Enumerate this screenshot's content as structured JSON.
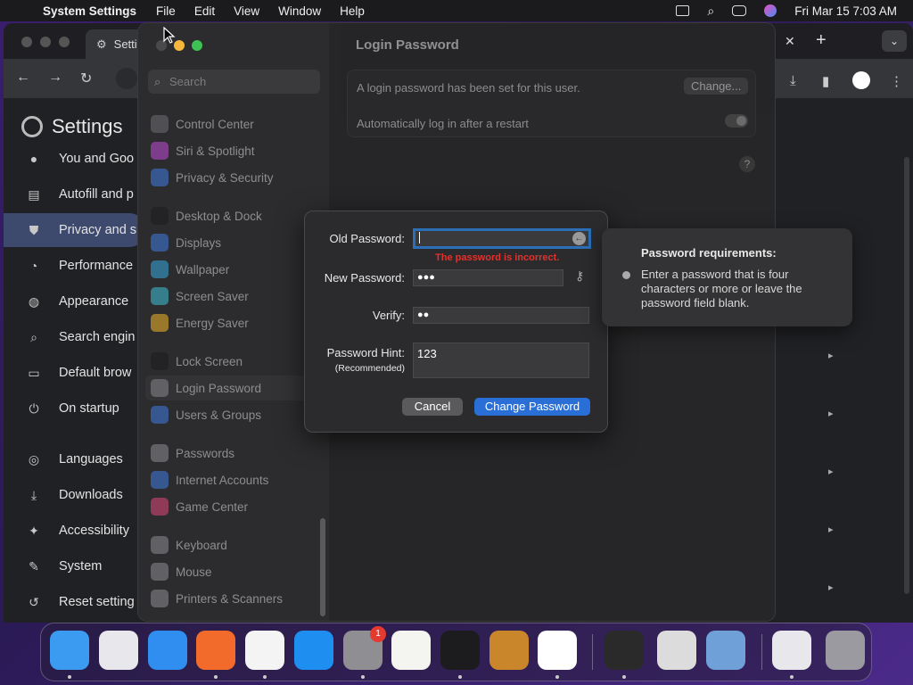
{
  "menubar": {
    "app": "System Settings",
    "items": [
      "File",
      "Edit",
      "View",
      "Window",
      "Help"
    ],
    "datetime": "Fri Mar 15  7:03 AM"
  },
  "chrome": {
    "tab_title": "Setti",
    "settings_title": "Settings",
    "sidebar": [
      {
        "label": "You and Goo",
        "icon": "person-icon"
      },
      {
        "label": "Autofill and p",
        "icon": "clipboard-icon"
      },
      {
        "label": "Privacy and s",
        "icon": "shield-icon",
        "active": true
      },
      {
        "label": "Performance",
        "icon": "speedometer-icon"
      },
      {
        "label": "Appearance",
        "icon": "palette-icon"
      },
      {
        "label": "Search engin",
        "icon": "search-icon"
      },
      {
        "label": "Default brow",
        "icon": "browser-icon"
      },
      {
        "label": "On startup",
        "icon": "power-icon"
      },
      {
        "label": "Languages",
        "icon": "globe-icon"
      },
      {
        "label": "Downloads",
        "icon": "download-icon"
      },
      {
        "label": "Accessibility",
        "icon": "accessibility-icon"
      },
      {
        "label": "System",
        "icon": "wrench-icon"
      },
      {
        "label": "Reset setting",
        "icon": "reset-icon"
      }
    ]
  },
  "system_settings": {
    "search_placeholder": "Search",
    "sidebar": [
      {
        "label": "Control Center",
        "color": "#6e6e73"
      },
      {
        "label": "Siri & Spotlight",
        "color": "#c24bd8"
      },
      {
        "label": "Privacy & Security",
        "color": "#3f7be0"
      },
      {
        "label": "Desktop & Dock",
        "color": "#1c1c1e"
      },
      {
        "label": "Displays",
        "color": "#3f7be0"
      },
      {
        "label": "Wallpaper",
        "color": "#38a8e0"
      },
      {
        "label": "Screen Saver",
        "color": "#3fc2d8"
      },
      {
        "label": "Energy Saver",
        "color": "#f2b52a"
      },
      {
        "label": "Lock Screen",
        "color": "#1c1c1e"
      },
      {
        "label": "Login Password",
        "color": "#8e8e93",
        "selected": true
      },
      {
        "label": "Users & Groups",
        "color": "#3f7be0"
      },
      {
        "label": "Passwords",
        "color": "#8e8e93"
      },
      {
        "label": "Internet Accounts",
        "color": "#3f7be0"
      },
      {
        "label": "Game Center",
        "color": "#e0467a"
      },
      {
        "label": "Keyboard",
        "color": "#8e8e93"
      },
      {
        "label": "Mouse",
        "color": "#8e8e93"
      },
      {
        "label": "Printers & Scanners",
        "color": "#8e8e93"
      }
    ],
    "main_title": "Login Password",
    "password_set_text": "A login password has been set for this user.",
    "change_button": "Change...",
    "auto_login_text": "Automatically log in after a restart",
    "help": "?"
  },
  "dialog": {
    "old_label": "Old Password:",
    "error": "The password is incorrect.",
    "new_label": "New Password:",
    "new_value": "●●●",
    "verify_label": "Verify:",
    "verify_value": "●●",
    "hint_label": "Password Hint:",
    "hint_sub": "(Recommended)",
    "hint_value": "123",
    "cancel": "Cancel",
    "change": "Change Password"
  },
  "tooltip": {
    "title": "Password requirements:",
    "body": "Enter a password that is four characters or more or leave the password field blank."
  },
  "dock": {
    "apps": [
      {
        "name": "finder-icon",
        "color": "#3a9bf0"
      },
      {
        "name": "launchpad-icon",
        "color": "#e8e8ec"
      },
      {
        "name": "safari-icon",
        "color": "#2f8ef0"
      },
      {
        "name": "firefox-icon",
        "color": "#f26b2a"
      },
      {
        "name": "chrome-icon",
        "color": "#f4f4f4"
      },
      {
        "name": "app-store-icon",
        "color": "#1e8ef0"
      },
      {
        "name": "system-settings-icon",
        "color": "#8e8e93",
        "badge": "1"
      },
      {
        "name": "textedit-icon",
        "color": "#f4f4f0"
      },
      {
        "name": "terminal-icon",
        "color": "#1c1c1e"
      },
      {
        "name": "garageband-icon",
        "color": "#c9862a"
      },
      {
        "name": "vscode-icon",
        "color": "#ffffff"
      },
      {
        "name": "sketchup-icon",
        "color": "#2a2a2a"
      },
      {
        "name": "font-book-icon",
        "color": "#dcdcdc"
      },
      {
        "name": "virtualbox-icon",
        "color": "#6fa0d8"
      },
      {
        "name": "preview-icon",
        "color": "#e8e8ec"
      },
      {
        "name": "trash-icon",
        "color": "#9a9aa0"
      }
    ]
  }
}
